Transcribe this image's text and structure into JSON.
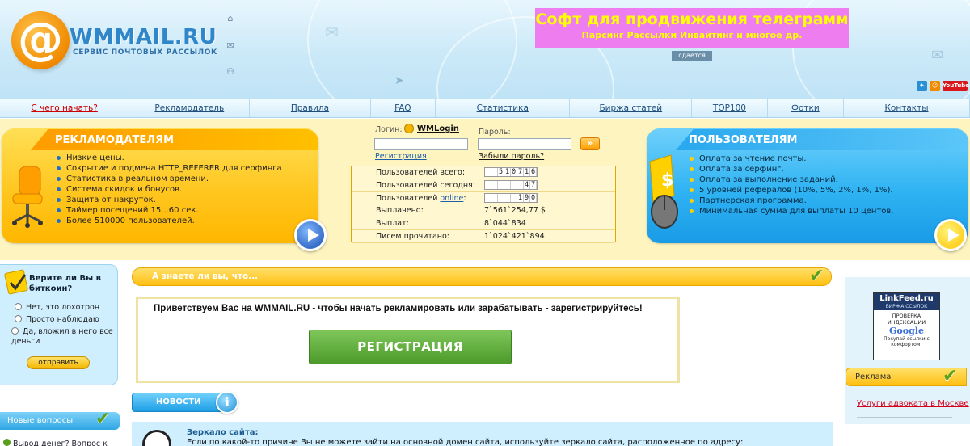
{
  "logo": {
    "symbol": "@",
    "name": "WMMAIL.RU",
    "tagline": "СЕРВИС ПОЧТОВЫХ РАССЫЛОК"
  },
  "banner": {
    "line1": "Софт для продвижения телеграмм",
    "line2": "Парсинг Рассылки Инвайтинг и многое др.",
    "rent_label": "сдается"
  },
  "social": [
    "YouTube"
  ],
  "nav": [
    {
      "label": "С чего начать?",
      "color": "#cc0000"
    },
    {
      "label": "Рекламодатель"
    },
    {
      "label": "Правила"
    },
    {
      "label": "FAQ"
    },
    {
      "label": "Статистика"
    },
    {
      "label": "Биржа статей"
    },
    {
      "label": "TOP100"
    },
    {
      "label": "Фотки"
    },
    {
      "label": "Контакты"
    }
  ],
  "advertisers": {
    "title": "РЕКЛАМОДАТЕЛЯМ",
    "items": [
      "Низкие цены.",
      "Сокрытие и подмена HTTP_REFERER для серфинга",
      "Статистика в реальном времени.",
      "Система скидок и бонусов.",
      "Защита от накруток.",
      "Таймер посещений 15...60 сек.",
      "Более 510000 пользователей."
    ]
  },
  "users": {
    "title": "ПОЛЬЗОВАТЕЛЯМ",
    "items": [
      "Оплата за чтение почты.",
      "Оплата за серфинг.",
      "Оплата за выполнение заданий.",
      "5 уровней рефералов (10%, 5%, 2%, 1%, 1%).",
      "Партнерская программа.",
      "Минимальная сумма для выплаты 10 центов."
    ]
  },
  "login": {
    "login_label": "Логин:",
    "wmlogin": "WMLogin",
    "password_label": "Пароль:",
    "register_link": "Регистрация",
    "forgot_link": "Забыли пароль?",
    "login_value": "",
    "password_value": ""
  },
  "stats": {
    "rows": [
      {
        "label": "Пользователей всего:",
        "value": "510716",
        "counter": true
      },
      {
        "label": "Пользователей сегодня:",
        "value": "47",
        "counter": true
      },
      {
        "label_prefix": "Пользователей ",
        "label_link": "online",
        "label_suffix": ":",
        "value": "190",
        "counter": true
      },
      {
        "label": "Выплачено:",
        "value": "7`561`254,77 $"
      },
      {
        "label": "Выплат:",
        "value": "8`044`834"
      },
      {
        "label": "Писем прочитано:",
        "value": "1`024`421`894"
      }
    ]
  },
  "poll": {
    "question": "Верите ли Вы в биткоин?",
    "options": [
      "Нет, это лохотрон",
      "Просто наблюдаю",
      "Да, вложил в него все деньги"
    ],
    "submit": "отправить"
  },
  "new_questions": {
    "title": "Новые вопросы",
    "item": "Вывод денег? Вопрос к"
  },
  "know": {
    "title": "А знаете ли вы, что..."
  },
  "welcome": {
    "text": "Приветствуем Вас на WMMAIL.RU - чтобы начать рекламировать или зарабатывать - зарегистрируйтесь!",
    "button": "РЕГИСТРАЦИЯ"
  },
  "news": {
    "tab": "НОВОСТИ",
    "info_icon": "i",
    "headline": "Зеркало сайта:",
    "body": "Если по какой-то причине Вы не можете зайти на основной домен сайта, используйте зеркало сайта, расположенное по адресу:"
  },
  "linkfeed": {
    "title": "LinkFeed.ru",
    "subtitle": "БИРЖА ССЫЛОК",
    "line_a": "ПРОВЕРКА ИНДЕКСАЦИИ",
    "google": "Google",
    "line_b": "Покупай ссылки с комфортом!"
  },
  "ads": {
    "title": "Реклама",
    "link": "Услуги адвоката в Москве"
  },
  "colors": {
    "accent_orange": "#ffc61f",
    "accent_blue": "#2fb3f3",
    "banner_pink": "#ee7ef0",
    "banner_text": "#ffff00"
  }
}
